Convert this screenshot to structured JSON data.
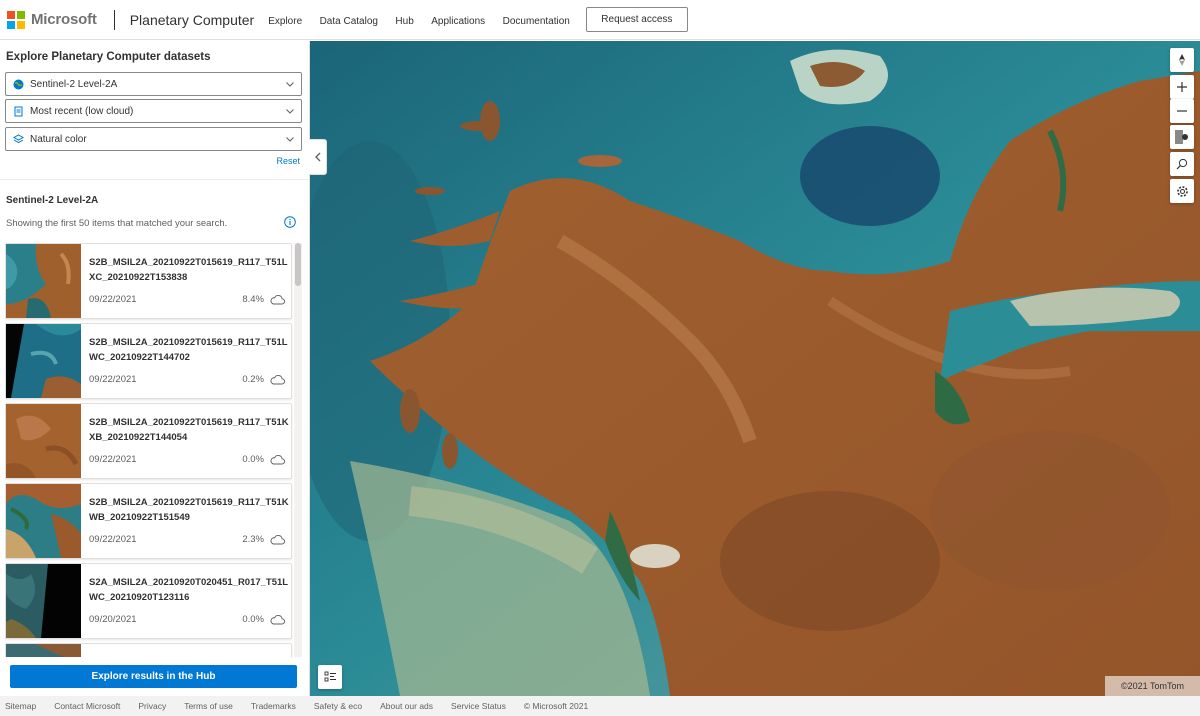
{
  "header": {
    "brand": "Microsoft",
    "site_title": "Planetary Computer",
    "nav": [
      "Explore",
      "Data Catalog",
      "Hub",
      "Applications",
      "Documentation"
    ],
    "request_access": "Request access",
    "logo_colors": [
      "#f25022",
      "#7fba00",
      "#00a4ef",
      "#ffb900"
    ]
  },
  "sidebar": {
    "title": "Explore Planetary Computer datasets",
    "dataset": "Sentinel-2 Level-2A",
    "query": "Most recent (low cloud)",
    "render": "Natural color",
    "reset": "Reset",
    "collection_title": "Sentinel-2 Level-2A",
    "showing_text": "Showing the first 50 items that matched your search.",
    "explore_button": "Explore results in the Hub"
  },
  "items": [
    {
      "id": "S2B_MSIL2A_20210922T015619_R117_T51LXC_20210922T153838",
      "date": "09/22/2021",
      "cloud": "8.4%"
    },
    {
      "id": "S2B_MSIL2A_20210922T015619_R117_T51LWC_20210922T144702",
      "date": "09/22/2021",
      "cloud": "0.2%"
    },
    {
      "id": "S2B_MSIL2A_20210922T015619_R117_T51KXB_20210922T144054",
      "date": "09/22/2021",
      "cloud": "0.0%"
    },
    {
      "id": "S2B_MSIL2A_20210922T015619_R117_T51KWB_20210922T151549",
      "date": "09/22/2021",
      "cloud": "2.3%"
    },
    {
      "id": "S2A_MSIL2A_20210920T020451_R017_T51LWC_20210920T123116",
      "date": "09/20/2021",
      "cloud": "0.0%"
    }
  ],
  "map": {
    "attribution": "©2021 TomTom",
    "controls": [
      "compass-icon",
      "zoom-in-icon",
      "zoom-out-icon",
      "layer-toggle-icon",
      "search-icon",
      "settings-icon"
    ]
  },
  "footer": [
    "Sitemap",
    "Contact Microsoft",
    "Privacy",
    "Terms of use",
    "Trademarks",
    "Safety & eco",
    "About our ads",
    "Service Status",
    "© Microsoft 2021"
  ],
  "colors": {
    "accent": "#0078d4",
    "water": "#1f6f7a",
    "land": "#a35f30"
  }
}
